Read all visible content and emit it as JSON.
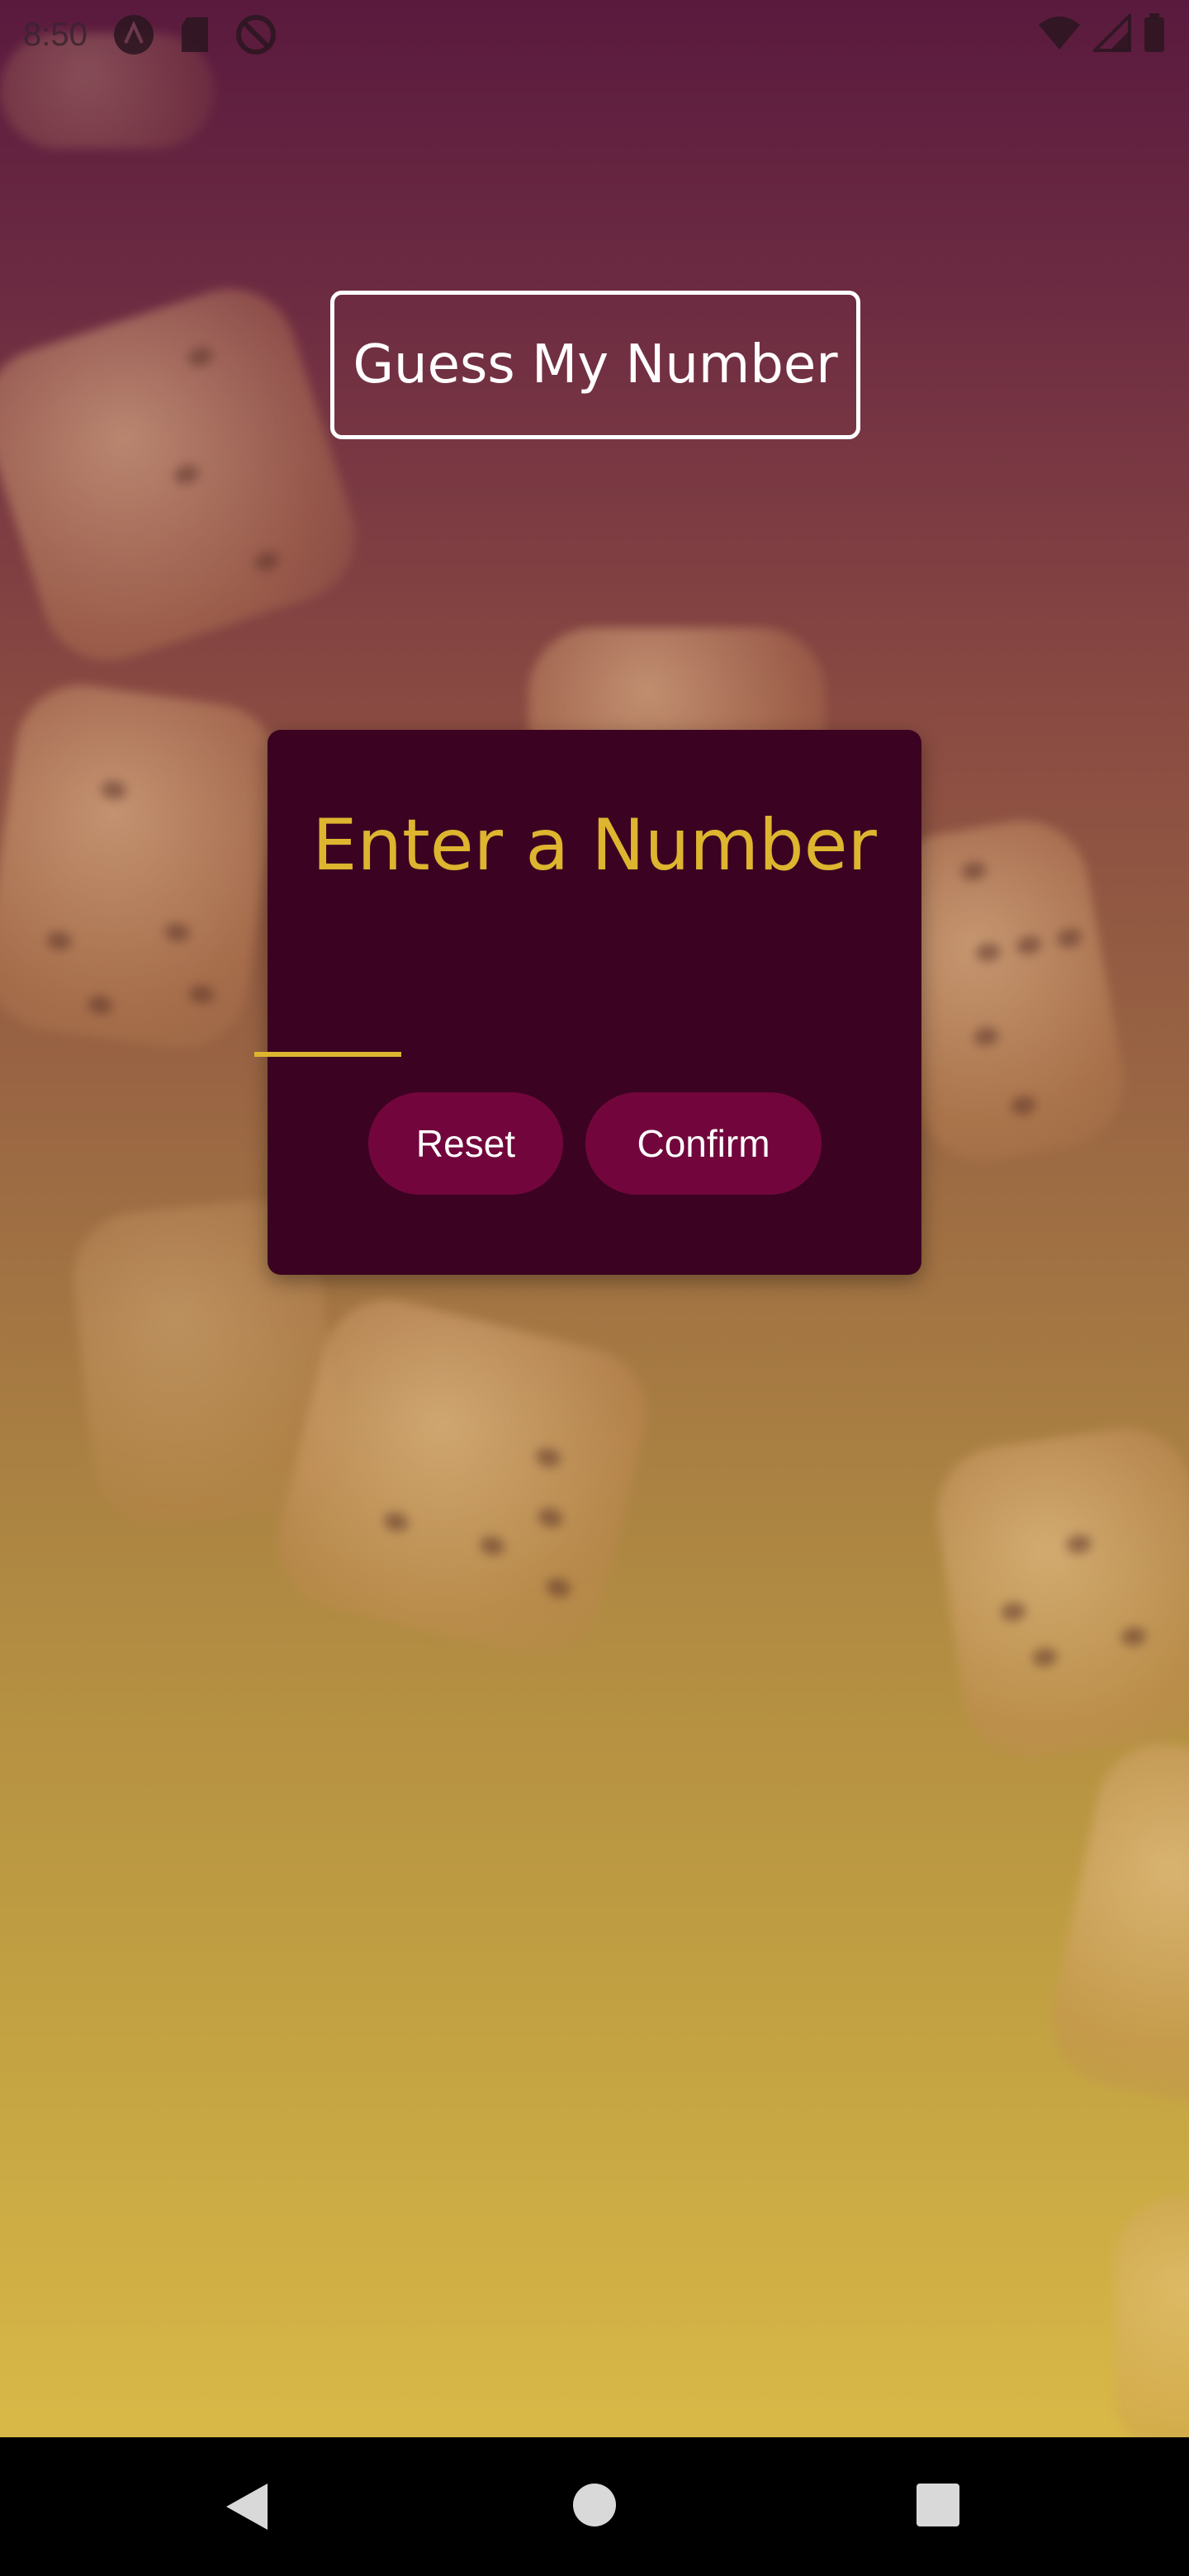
{
  "status_bar": {
    "time": "8:50",
    "left_icons": [
      "app-icon",
      "sd-card-icon",
      "do-not-disturb-icon"
    ],
    "right_icons": [
      "wifi-icon",
      "signal-icon",
      "battery-icon"
    ]
  },
  "header": {
    "title": "Guess My Number"
  },
  "card": {
    "title": "Enter a Number",
    "input_value": "",
    "reset_label": "Reset",
    "confirm_label": "Confirm"
  },
  "colors": {
    "accent": "#ddb52f",
    "card_background": "#3b0222",
    "button_background": "#72063c",
    "gradient_top": "#5a1a3e",
    "gradient_bottom": "#d8b847"
  },
  "nav_bar": {
    "icons": [
      "back-icon",
      "home-icon",
      "recents-icon"
    ]
  }
}
